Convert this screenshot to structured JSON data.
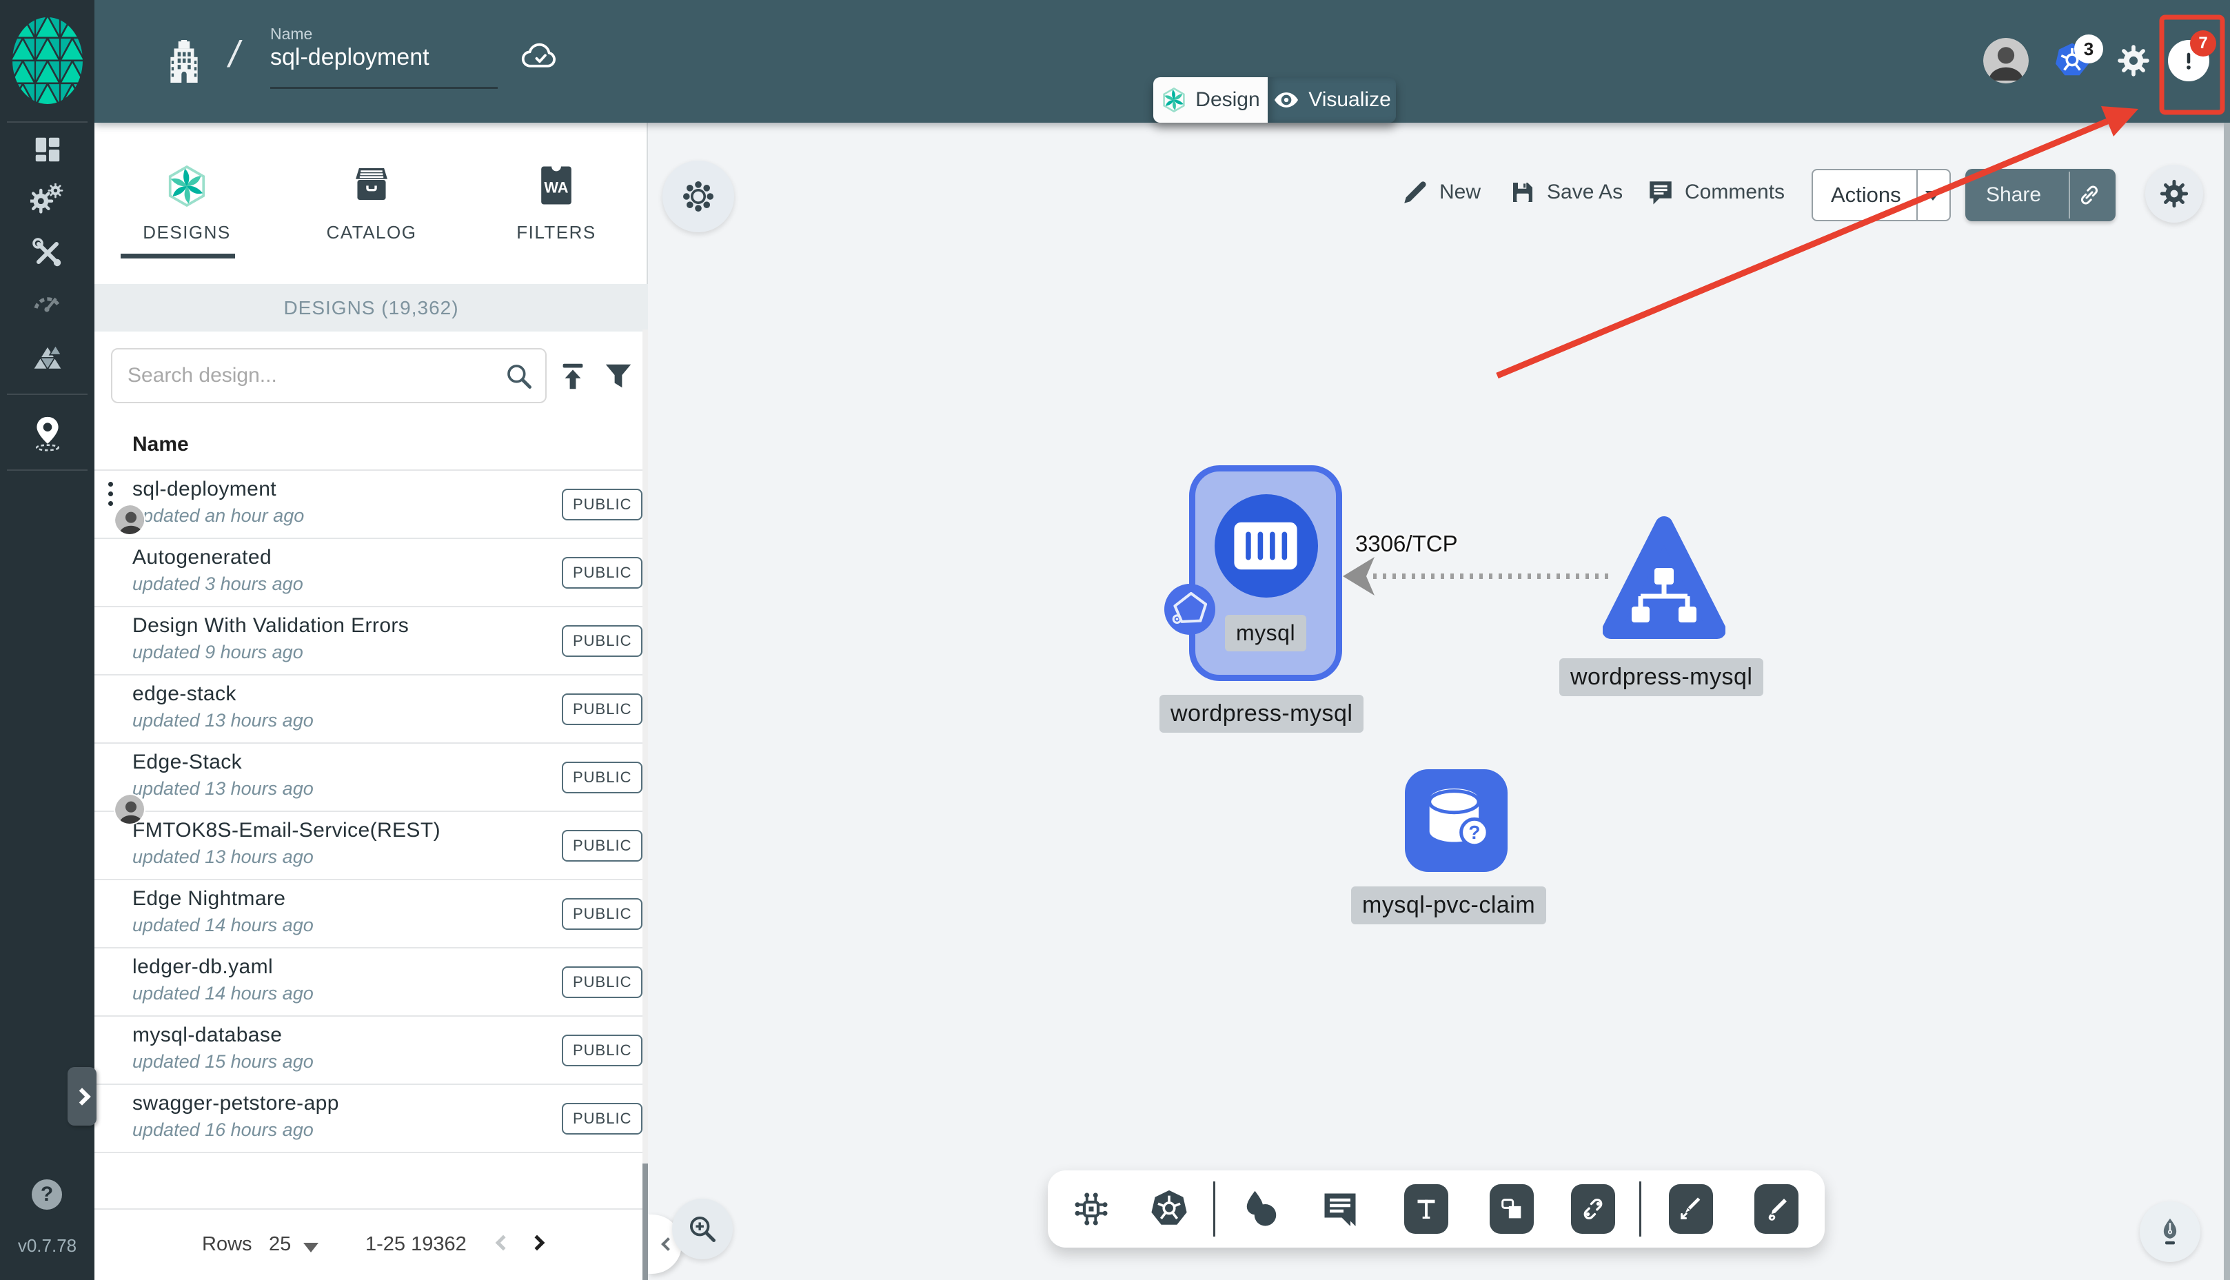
{
  "app": {
    "version": "v0.7.78"
  },
  "colors": {
    "brand_green": "#00B39F",
    "node_blue": "#426DE4",
    "annotation_red": "#E8402F",
    "header_teal": "#3E5C66",
    "sidebar_dark": "#263238"
  },
  "header": {
    "name_label": "Name",
    "design_name": "sql-deployment",
    "mode_tabs": [
      {
        "label": "Design"
      },
      {
        "label": "Visualize"
      }
    ],
    "kubernetes_context_count": "3",
    "notification_count": "7"
  },
  "left_panel": {
    "tabs": [
      {
        "label": "DESIGNS"
      },
      {
        "label": "CATALOG"
      },
      {
        "label": "FILTERS"
      }
    ],
    "section_title": "DESIGNS (19,362)",
    "search_placeholder": "Search design...",
    "column_header": "Name",
    "designs": [
      {
        "name": "sql-deployment",
        "updated": "updated an hour ago",
        "visibility": "PUBLIC"
      },
      {
        "name": "Autogenerated",
        "updated": "updated 3 hours ago",
        "visibility": "PUBLIC"
      },
      {
        "name": "Design With Validation Errors",
        "updated": "updated 9 hours ago",
        "visibility": "PUBLIC"
      },
      {
        "name": "edge-stack",
        "updated": "updated 13 hours ago",
        "visibility": "PUBLIC"
      },
      {
        "name": "Edge-Stack",
        "updated": "updated 13 hours ago",
        "visibility": "PUBLIC"
      },
      {
        "name": "FMTOK8S-Email-Service(REST)",
        "updated": "updated 13 hours ago",
        "visibility": "PUBLIC"
      },
      {
        "name": "Edge Nightmare",
        "updated": "updated 14 hours ago",
        "visibility": "PUBLIC"
      },
      {
        "name": "ledger-db.yaml",
        "updated": "updated 14 hours ago",
        "visibility": "PUBLIC"
      },
      {
        "name": "mysql-database",
        "updated": "updated 15 hours ago",
        "visibility": "PUBLIC"
      },
      {
        "name": "swagger-petstore-app",
        "updated": "updated 16 hours ago",
        "visibility": "PUBLIC"
      }
    ],
    "pagination": {
      "rows_label": "Rows",
      "rows_per_page": "25",
      "range": "1-25 19362"
    }
  },
  "canvas": {
    "toolbar": {
      "new_label": "New",
      "save_as_label": "Save As",
      "comments_label": "Comments",
      "actions_label": "Actions",
      "share_label": "Share"
    },
    "edge": {
      "label": "3306/TCP"
    },
    "nodes": {
      "mysql": {
        "label": "mysql",
        "sublabel": "wordpress-mysql"
      },
      "service": {
        "label": "wordpress-mysql"
      },
      "pvc": {
        "label": "mysql-pvc-claim"
      }
    }
  }
}
